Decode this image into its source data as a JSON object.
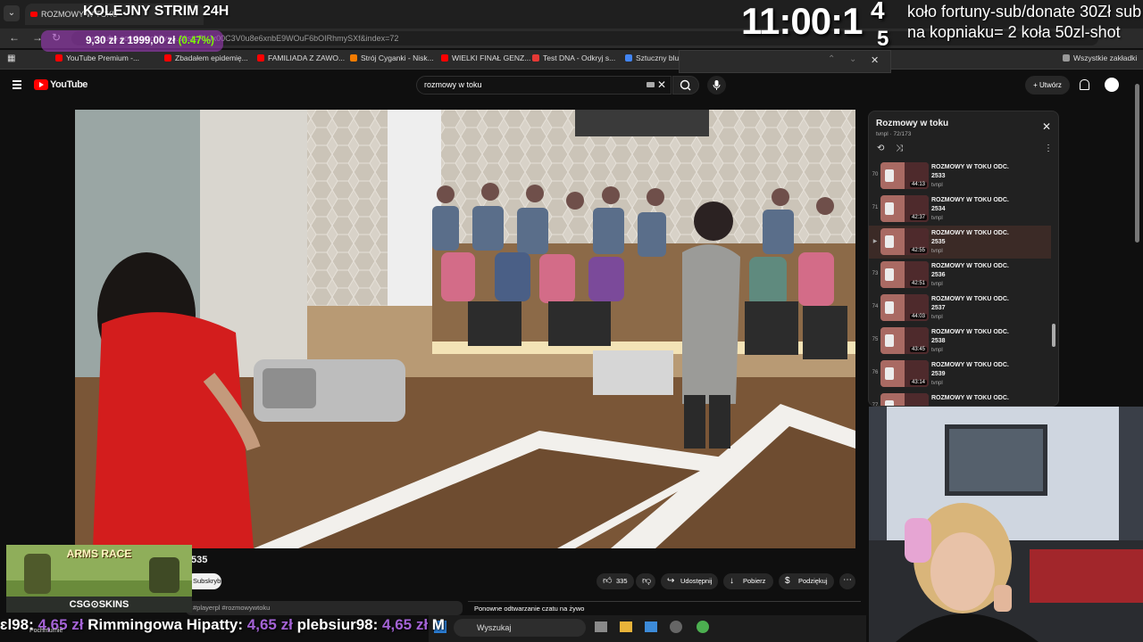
{
  "browser": {
    "tab_title": "ROZMOWY W TOKU",
    "url": "youtube.com/watch?v=...&list=PLJx00C3V0u8e6xnbE9WOuF6bOIRhmySXf&index=72",
    "bookmarks": [
      {
        "label": "YouTube Premium -...",
        "color": "#ff0000"
      },
      {
        "label": "Zbadałem epidemię...",
        "color": "#ff0000"
      },
      {
        "label": "FAMILIADA Z ZAWO...",
        "color": "#ff0000"
      },
      {
        "label": "Strój Cyganki - Nisk...",
        "color": "#f57c00"
      },
      {
        "label": "WIELKI FINAŁ GENZ...",
        "color": "#ff0000"
      },
      {
        "label": "Test DNA - Odkryj s...",
        "color": "#e53935"
      },
      {
        "label": "Sztuczny blus",
        "color": "#4285f4"
      },
      {
        "label": "Wszystkie zakładki",
        "color": "#999999"
      }
    ]
  },
  "overlay": {
    "stream_title": "KOLEJNY STRIM 24H",
    "price": "9,30 zł z 1999,00 zł",
    "price_pct": "(0.47%)",
    "clock": "11:00:1",
    "clock_sup": "4",
    "clock_sub": "5",
    "note": "koło fortuny-sub/donate 30Zł sub na kopniaku= 2 koła 50zl-shot"
  },
  "youtube": {
    "logo_text": "YouTube",
    "search_value": "rozmowy w toku",
    "create_label": "Utwórz",
    "video_title": "535",
    "subscribe_label": "Subskrybuj",
    "likes": "335",
    "share_label": "Udostępnij",
    "download_label": "Pobierz",
    "thanks_label": "Podziękuj",
    "description": "#playerpl #rozmowywtoku",
    "replay_label": "Ponowne odtwarzanie czatu na żywo"
  },
  "playlist": {
    "title": "Rozmowy w toku",
    "meta": "tvnpl · 72/173",
    "items": [
      {
        "idx": "70",
        "title": "ROZMOWY W TOKU ODC. 2533",
        "duration": "44:13",
        "channel": "tvnpl",
        "active": false
      },
      {
        "idx": "71",
        "title": "ROZMOWY W TOKU ODC. 2534",
        "duration": "42:37",
        "channel": "tvnpl",
        "active": false
      },
      {
        "idx": "▶",
        "title": "ROZMOWY W TOKU ODC. 2535",
        "duration": "42:55",
        "channel": "tvnpl",
        "active": true
      },
      {
        "idx": "73",
        "title": "ROZMOWY W TOKU ODC. 2536",
        "duration": "42:51",
        "channel": "tvnpl",
        "active": false
      },
      {
        "idx": "74",
        "title": "ROZMOWY W TOKU ODC. 2537",
        "duration": "44:03",
        "channel": "tvnpl",
        "active": false
      },
      {
        "idx": "75",
        "title": "ROZMOWY W TOKU ODC. 2538",
        "duration": "43:45",
        "channel": "tvnpl",
        "active": false
      },
      {
        "idx": "76",
        "title": "ROZMOWY W TOKU ODC. 2539",
        "duration": "43:14",
        "channel": "tvnpl",
        "active": false
      },
      {
        "idx": "77",
        "title": "ROZMOWY W TOKU ODC.",
        "duration": "",
        "channel": "",
        "active": false
      }
    ]
  },
  "bottom": {
    "csgo_title": "ARMS RACE",
    "csgo_brand": "CSG⊙SKINS",
    "ticker": [
      {
        "name": "ɛl98:",
        "amount": "4,65 zł"
      },
      {
        "name": "Rimmingowa Hipatty:",
        "amount": "4,65 zł"
      },
      {
        "name": "plebsiur98:",
        "amount": "4,65 zł"
      },
      {
        "name": "M",
        "amount": ""
      }
    ],
    "taskbar_search": "Wyszukaj",
    "weather": "Pochmurnie"
  }
}
